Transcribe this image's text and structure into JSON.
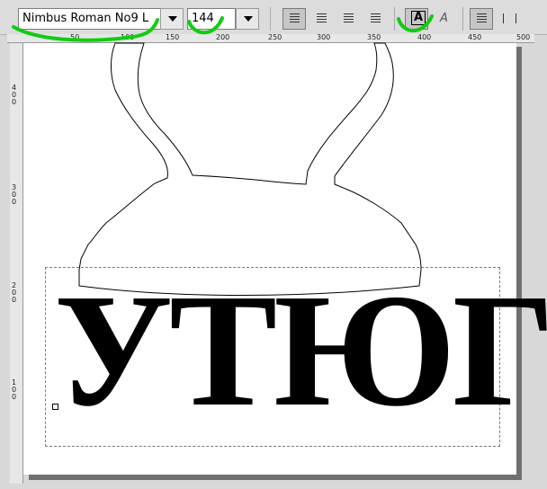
{
  "toolbar": {
    "font_name": "Nimbus Roman No9 L",
    "font_size": "144",
    "bold_glyph": "A",
    "italic_glyph": "A"
  },
  "ruler": {
    "h_ticks": [
      "50",
      "100",
      "150",
      "200",
      "250",
      "300",
      "350",
      "400",
      "450",
      "500"
    ],
    "v_ticks": [
      "400",
      "300",
      "200",
      "100"
    ]
  },
  "canvas": {
    "text": "УТЮГ"
  },
  "annotation_color": "#11cc11"
}
